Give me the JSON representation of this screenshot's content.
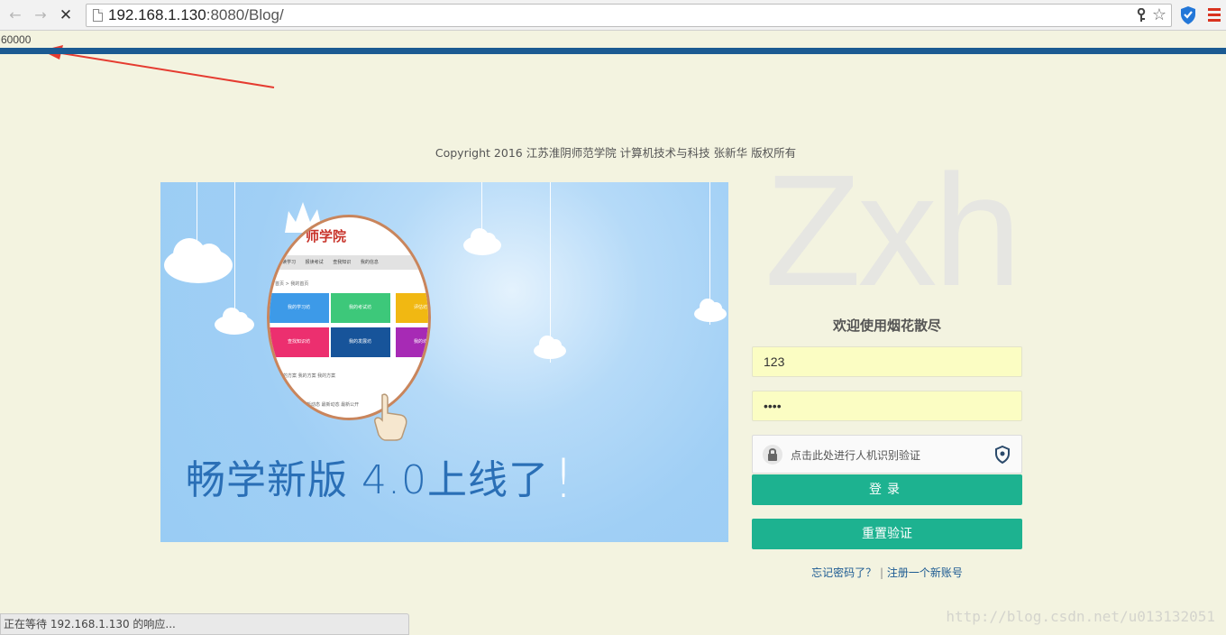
{
  "browser": {
    "url_host": "192.168.1.130",
    "url_path": ":8080/Blog/",
    "status_text": "正在等待 192.168.1.130 的响应..."
  },
  "page": {
    "counter": "60000",
    "copyright": "Copyright 2016 江苏淮阴师范学院 计算机技术与科技 张新华 版权所有",
    "logo_text": "Zxh",
    "welcome": "欢迎使用烟花散尽",
    "watermark": "http://blog.csdn.net/u013132051"
  },
  "banner": {
    "headline": "畅学新版 4.0上线了",
    "exclaim": "!",
    "mini_title": "师学院",
    "mini_nav": [
      "报读学习",
      "报读考试",
      "查我知识",
      "我的信息"
    ],
    "mini_crumb": "首页 > 我的首页",
    "tiles": [
      {
        "label": "我的学习坊",
        "color": "#3d9ae8"
      },
      {
        "label": "我的考试坊",
        "color": "#3dc87a"
      },
      {
        "label": "评估坊",
        "color": "#f1b812"
      },
      {
        "label": "查找知识坊",
        "color": "#ec2f6f"
      },
      {
        "label": "我的发展坊",
        "color": "#17549a"
      },
      {
        "label": "我的坊",
        "color": "#a72ab5"
      }
    ],
    "mini_row": "我的方案    我的方案    我的方案",
    "mini_row2": "最新动态    最新动态    最新公开"
  },
  "form": {
    "username_value": "123",
    "password_value": "••••",
    "captcha_text": "点击此处进行人机识别验证",
    "login_label": "登录",
    "reset_label": "重置验证",
    "forgot_label": "忘记密码了？",
    "separator": "|",
    "register_label": "注册一个新账号"
  },
  "colors": {
    "accent_green": "#1db290",
    "top_bar_blue": "#1b5a92",
    "input_yellow": "#fbfdc3",
    "page_bg": "#f3f3e0"
  }
}
